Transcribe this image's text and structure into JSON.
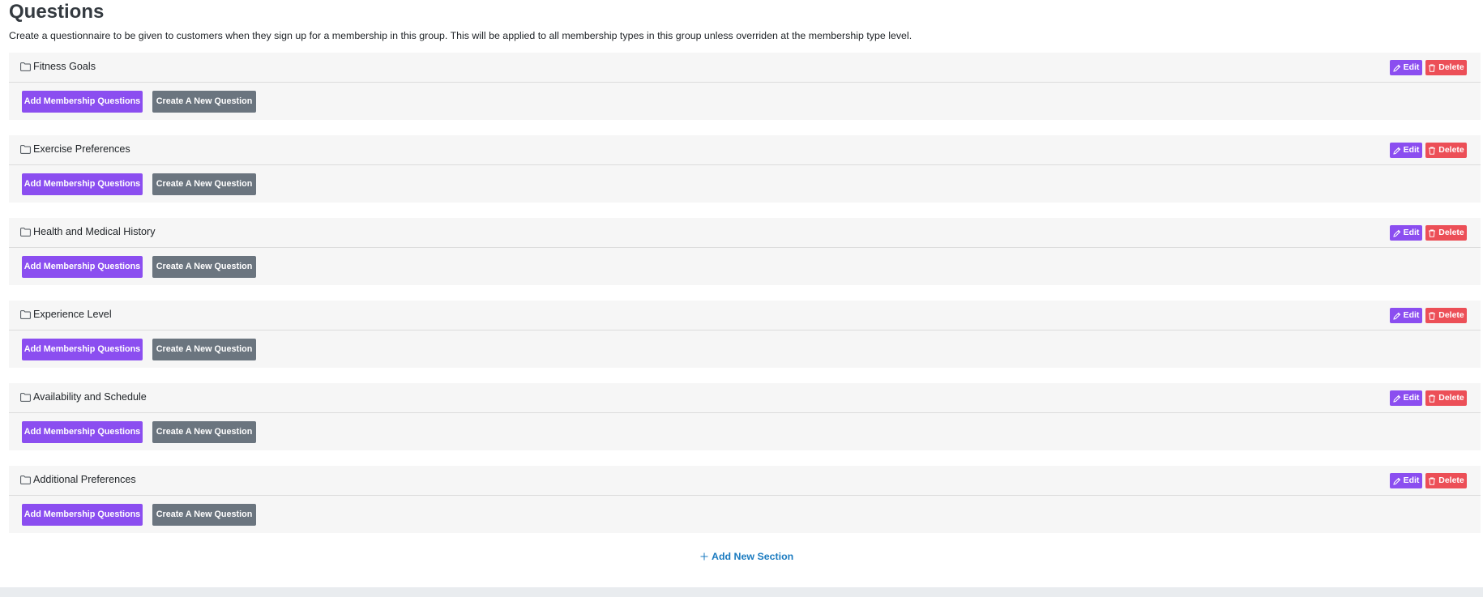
{
  "page": {
    "title": "Questions",
    "description": "Create a questionnaire to be given to customers when they sign up for a membership in this group. This will be applied to all membership types in this group unless overriden at the membership type level."
  },
  "section_buttons": {
    "edit_label": "Edit",
    "delete_label": "Delete",
    "add_questions_label": "Add Membership Questions",
    "create_question_label": "Create A New Question"
  },
  "sections": [
    {
      "title": "Fitness Goals"
    },
    {
      "title": "Exercise Preferences"
    },
    {
      "title": "Health and Medical History"
    },
    {
      "title": "Experience Level"
    },
    {
      "title": "Availability and Schedule"
    },
    {
      "title": "Additional Preferences"
    }
  ],
  "add_section": {
    "label": "Add New Section"
  },
  "icons": {
    "section": "folder-icon",
    "edit": "pencil-icon",
    "delete": "trash-icon",
    "add": "plus-icon"
  },
  "colors": {
    "primary_purple": "#8b4ef0",
    "danger_red": "#ec4f57",
    "secondary_gray": "#6b757f",
    "link_blue": "#1b7bc0",
    "section_bg": "#f6f6f6"
  }
}
